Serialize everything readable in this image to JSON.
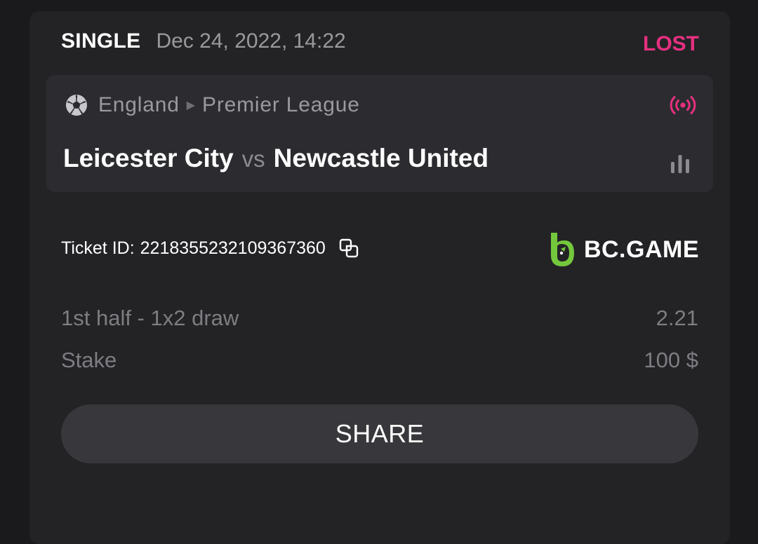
{
  "bet": {
    "type": "SINGLE",
    "date": "Dec 24, 2022, 14:22",
    "status": "LOST"
  },
  "match": {
    "country": "England",
    "league": "Premier League",
    "home_team": "Leicester City",
    "vs": "vs",
    "away_team": "Newcastle United"
  },
  "ticket": {
    "label": "Ticket ID:",
    "id": "2218355232109367360"
  },
  "brand": {
    "name": "BC.GAME"
  },
  "selection": {
    "label": "1st half - 1x2 draw",
    "odds": "2.21"
  },
  "stake": {
    "label": "Stake",
    "value": "100 $"
  },
  "actions": {
    "share_label": "SHARE"
  },
  "colors": {
    "lost": "#e6307f",
    "live": "#e6307f",
    "brand_green": "#74c83c",
    "card_bg": "#232326",
    "match_bg": "#2c2c30",
    "button_bg": "#38383c"
  },
  "icons": {
    "sport": "soccer-ball-icon",
    "live": "live-broadcast-icon",
    "stats": "bar-chart-icon",
    "copy": "copy-icon"
  }
}
